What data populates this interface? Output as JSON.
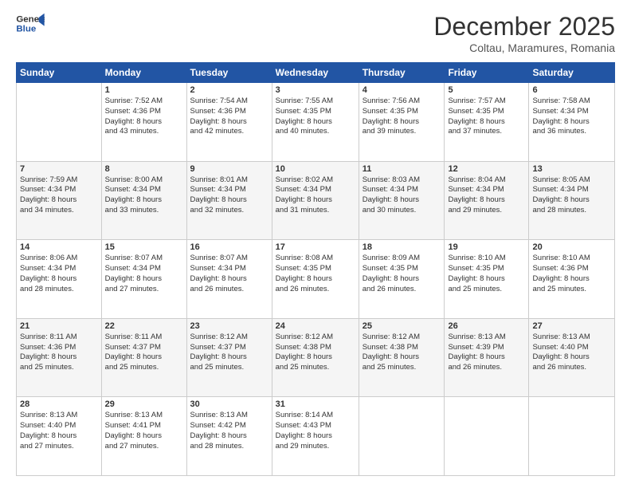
{
  "header": {
    "logo_line1": "General",
    "logo_line2": "Blue",
    "month": "December 2025",
    "location": "Coltau, Maramures, Romania"
  },
  "days_of_week": [
    "Sunday",
    "Monday",
    "Tuesday",
    "Wednesday",
    "Thursday",
    "Friday",
    "Saturday"
  ],
  "weeks": [
    [
      {
        "day": "",
        "info": ""
      },
      {
        "day": "1",
        "info": "Sunrise: 7:52 AM\nSunset: 4:36 PM\nDaylight: 8 hours\nand 43 minutes."
      },
      {
        "day": "2",
        "info": "Sunrise: 7:54 AM\nSunset: 4:36 PM\nDaylight: 8 hours\nand 42 minutes."
      },
      {
        "day": "3",
        "info": "Sunrise: 7:55 AM\nSunset: 4:35 PM\nDaylight: 8 hours\nand 40 minutes."
      },
      {
        "day": "4",
        "info": "Sunrise: 7:56 AM\nSunset: 4:35 PM\nDaylight: 8 hours\nand 39 minutes."
      },
      {
        "day": "5",
        "info": "Sunrise: 7:57 AM\nSunset: 4:35 PM\nDaylight: 8 hours\nand 37 minutes."
      },
      {
        "day": "6",
        "info": "Sunrise: 7:58 AM\nSunset: 4:34 PM\nDaylight: 8 hours\nand 36 minutes."
      }
    ],
    [
      {
        "day": "7",
        "info": "Sunrise: 7:59 AM\nSunset: 4:34 PM\nDaylight: 8 hours\nand 34 minutes."
      },
      {
        "day": "8",
        "info": "Sunrise: 8:00 AM\nSunset: 4:34 PM\nDaylight: 8 hours\nand 33 minutes."
      },
      {
        "day": "9",
        "info": "Sunrise: 8:01 AM\nSunset: 4:34 PM\nDaylight: 8 hours\nand 32 minutes."
      },
      {
        "day": "10",
        "info": "Sunrise: 8:02 AM\nSunset: 4:34 PM\nDaylight: 8 hours\nand 31 minutes."
      },
      {
        "day": "11",
        "info": "Sunrise: 8:03 AM\nSunset: 4:34 PM\nDaylight: 8 hours\nand 30 minutes."
      },
      {
        "day": "12",
        "info": "Sunrise: 8:04 AM\nSunset: 4:34 PM\nDaylight: 8 hours\nand 29 minutes."
      },
      {
        "day": "13",
        "info": "Sunrise: 8:05 AM\nSunset: 4:34 PM\nDaylight: 8 hours\nand 28 minutes."
      }
    ],
    [
      {
        "day": "14",
        "info": "Sunrise: 8:06 AM\nSunset: 4:34 PM\nDaylight: 8 hours\nand 28 minutes."
      },
      {
        "day": "15",
        "info": "Sunrise: 8:07 AM\nSunset: 4:34 PM\nDaylight: 8 hours\nand 27 minutes."
      },
      {
        "day": "16",
        "info": "Sunrise: 8:07 AM\nSunset: 4:34 PM\nDaylight: 8 hours\nand 26 minutes."
      },
      {
        "day": "17",
        "info": "Sunrise: 8:08 AM\nSunset: 4:35 PM\nDaylight: 8 hours\nand 26 minutes."
      },
      {
        "day": "18",
        "info": "Sunrise: 8:09 AM\nSunset: 4:35 PM\nDaylight: 8 hours\nand 26 minutes."
      },
      {
        "day": "19",
        "info": "Sunrise: 8:10 AM\nSunset: 4:35 PM\nDaylight: 8 hours\nand 25 minutes."
      },
      {
        "day": "20",
        "info": "Sunrise: 8:10 AM\nSunset: 4:36 PM\nDaylight: 8 hours\nand 25 minutes."
      }
    ],
    [
      {
        "day": "21",
        "info": "Sunrise: 8:11 AM\nSunset: 4:36 PM\nDaylight: 8 hours\nand 25 minutes."
      },
      {
        "day": "22",
        "info": "Sunrise: 8:11 AM\nSunset: 4:37 PM\nDaylight: 8 hours\nand 25 minutes."
      },
      {
        "day": "23",
        "info": "Sunrise: 8:12 AM\nSunset: 4:37 PM\nDaylight: 8 hours\nand 25 minutes."
      },
      {
        "day": "24",
        "info": "Sunrise: 8:12 AM\nSunset: 4:38 PM\nDaylight: 8 hours\nand 25 minutes."
      },
      {
        "day": "25",
        "info": "Sunrise: 8:12 AM\nSunset: 4:38 PM\nDaylight: 8 hours\nand 25 minutes."
      },
      {
        "day": "26",
        "info": "Sunrise: 8:13 AM\nSunset: 4:39 PM\nDaylight: 8 hours\nand 26 minutes."
      },
      {
        "day": "27",
        "info": "Sunrise: 8:13 AM\nSunset: 4:40 PM\nDaylight: 8 hours\nand 26 minutes."
      }
    ],
    [
      {
        "day": "28",
        "info": "Sunrise: 8:13 AM\nSunset: 4:40 PM\nDaylight: 8 hours\nand 27 minutes."
      },
      {
        "day": "29",
        "info": "Sunrise: 8:13 AM\nSunset: 4:41 PM\nDaylight: 8 hours\nand 27 minutes."
      },
      {
        "day": "30",
        "info": "Sunrise: 8:13 AM\nSunset: 4:42 PM\nDaylight: 8 hours\nand 28 minutes."
      },
      {
        "day": "31",
        "info": "Sunrise: 8:14 AM\nSunset: 4:43 PM\nDaylight: 8 hours\nand 29 minutes."
      },
      {
        "day": "",
        "info": ""
      },
      {
        "day": "",
        "info": ""
      },
      {
        "day": "",
        "info": ""
      }
    ]
  ]
}
